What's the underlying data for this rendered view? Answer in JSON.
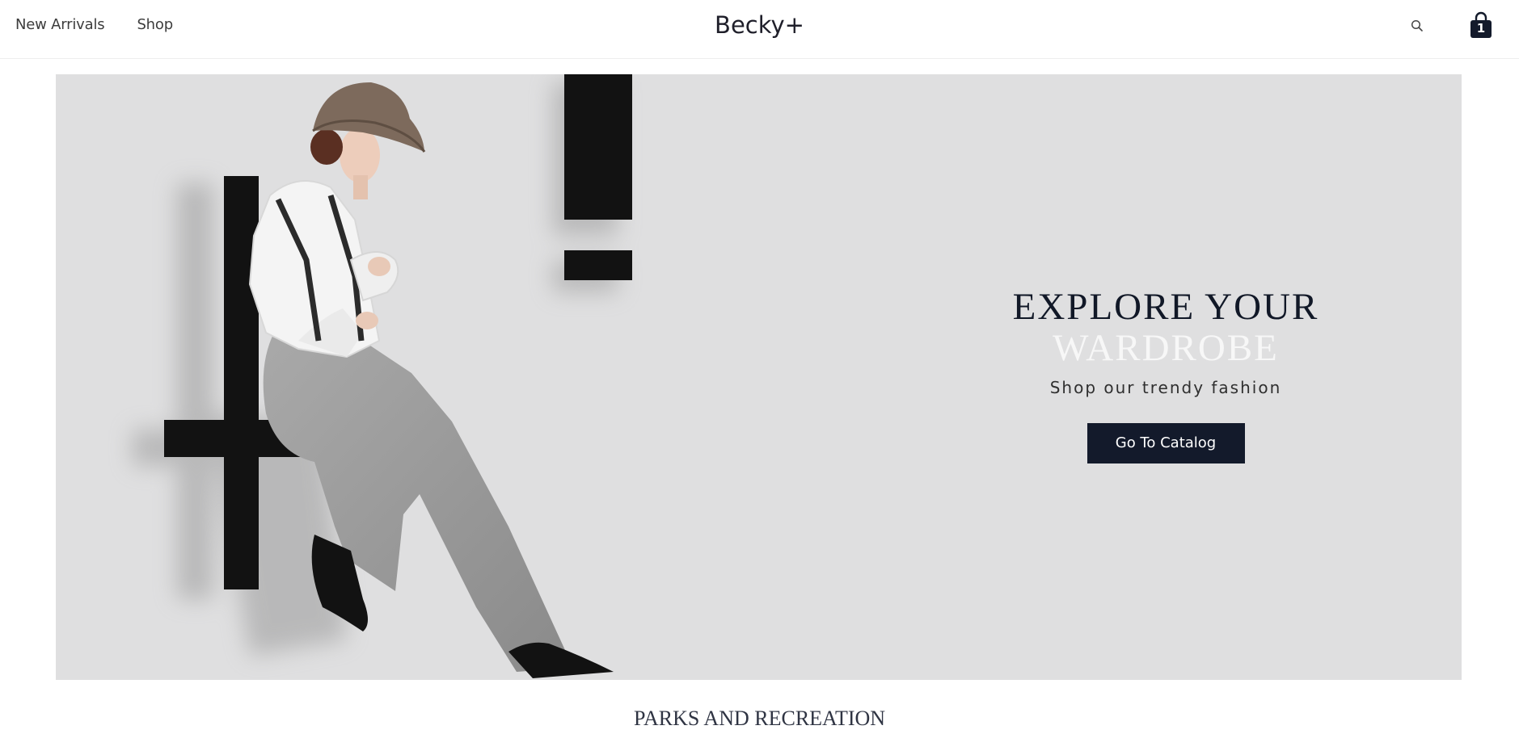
{
  "header": {
    "nav": [
      {
        "label": "New Arrivals"
      },
      {
        "label": "Shop"
      }
    ],
    "logo": "Becky+",
    "search_icon": "search-icon",
    "cart": {
      "icon": "shopping-bag-icon",
      "count": "1"
    }
  },
  "hero": {
    "title_line1": "EXPLORE YOUR",
    "title_line2": "WARDROBE",
    "subtitle": "Shop our trendy fashion",
    "cta_label": "Go To Catalog",
    "background_color": "#dfdfe0"
  },
  "section": {
    "title": "PARKS AND RECREATION"
  },
  "colors": {
    "accent": "#131a2b",
    "text": "#111827"
  }
}
